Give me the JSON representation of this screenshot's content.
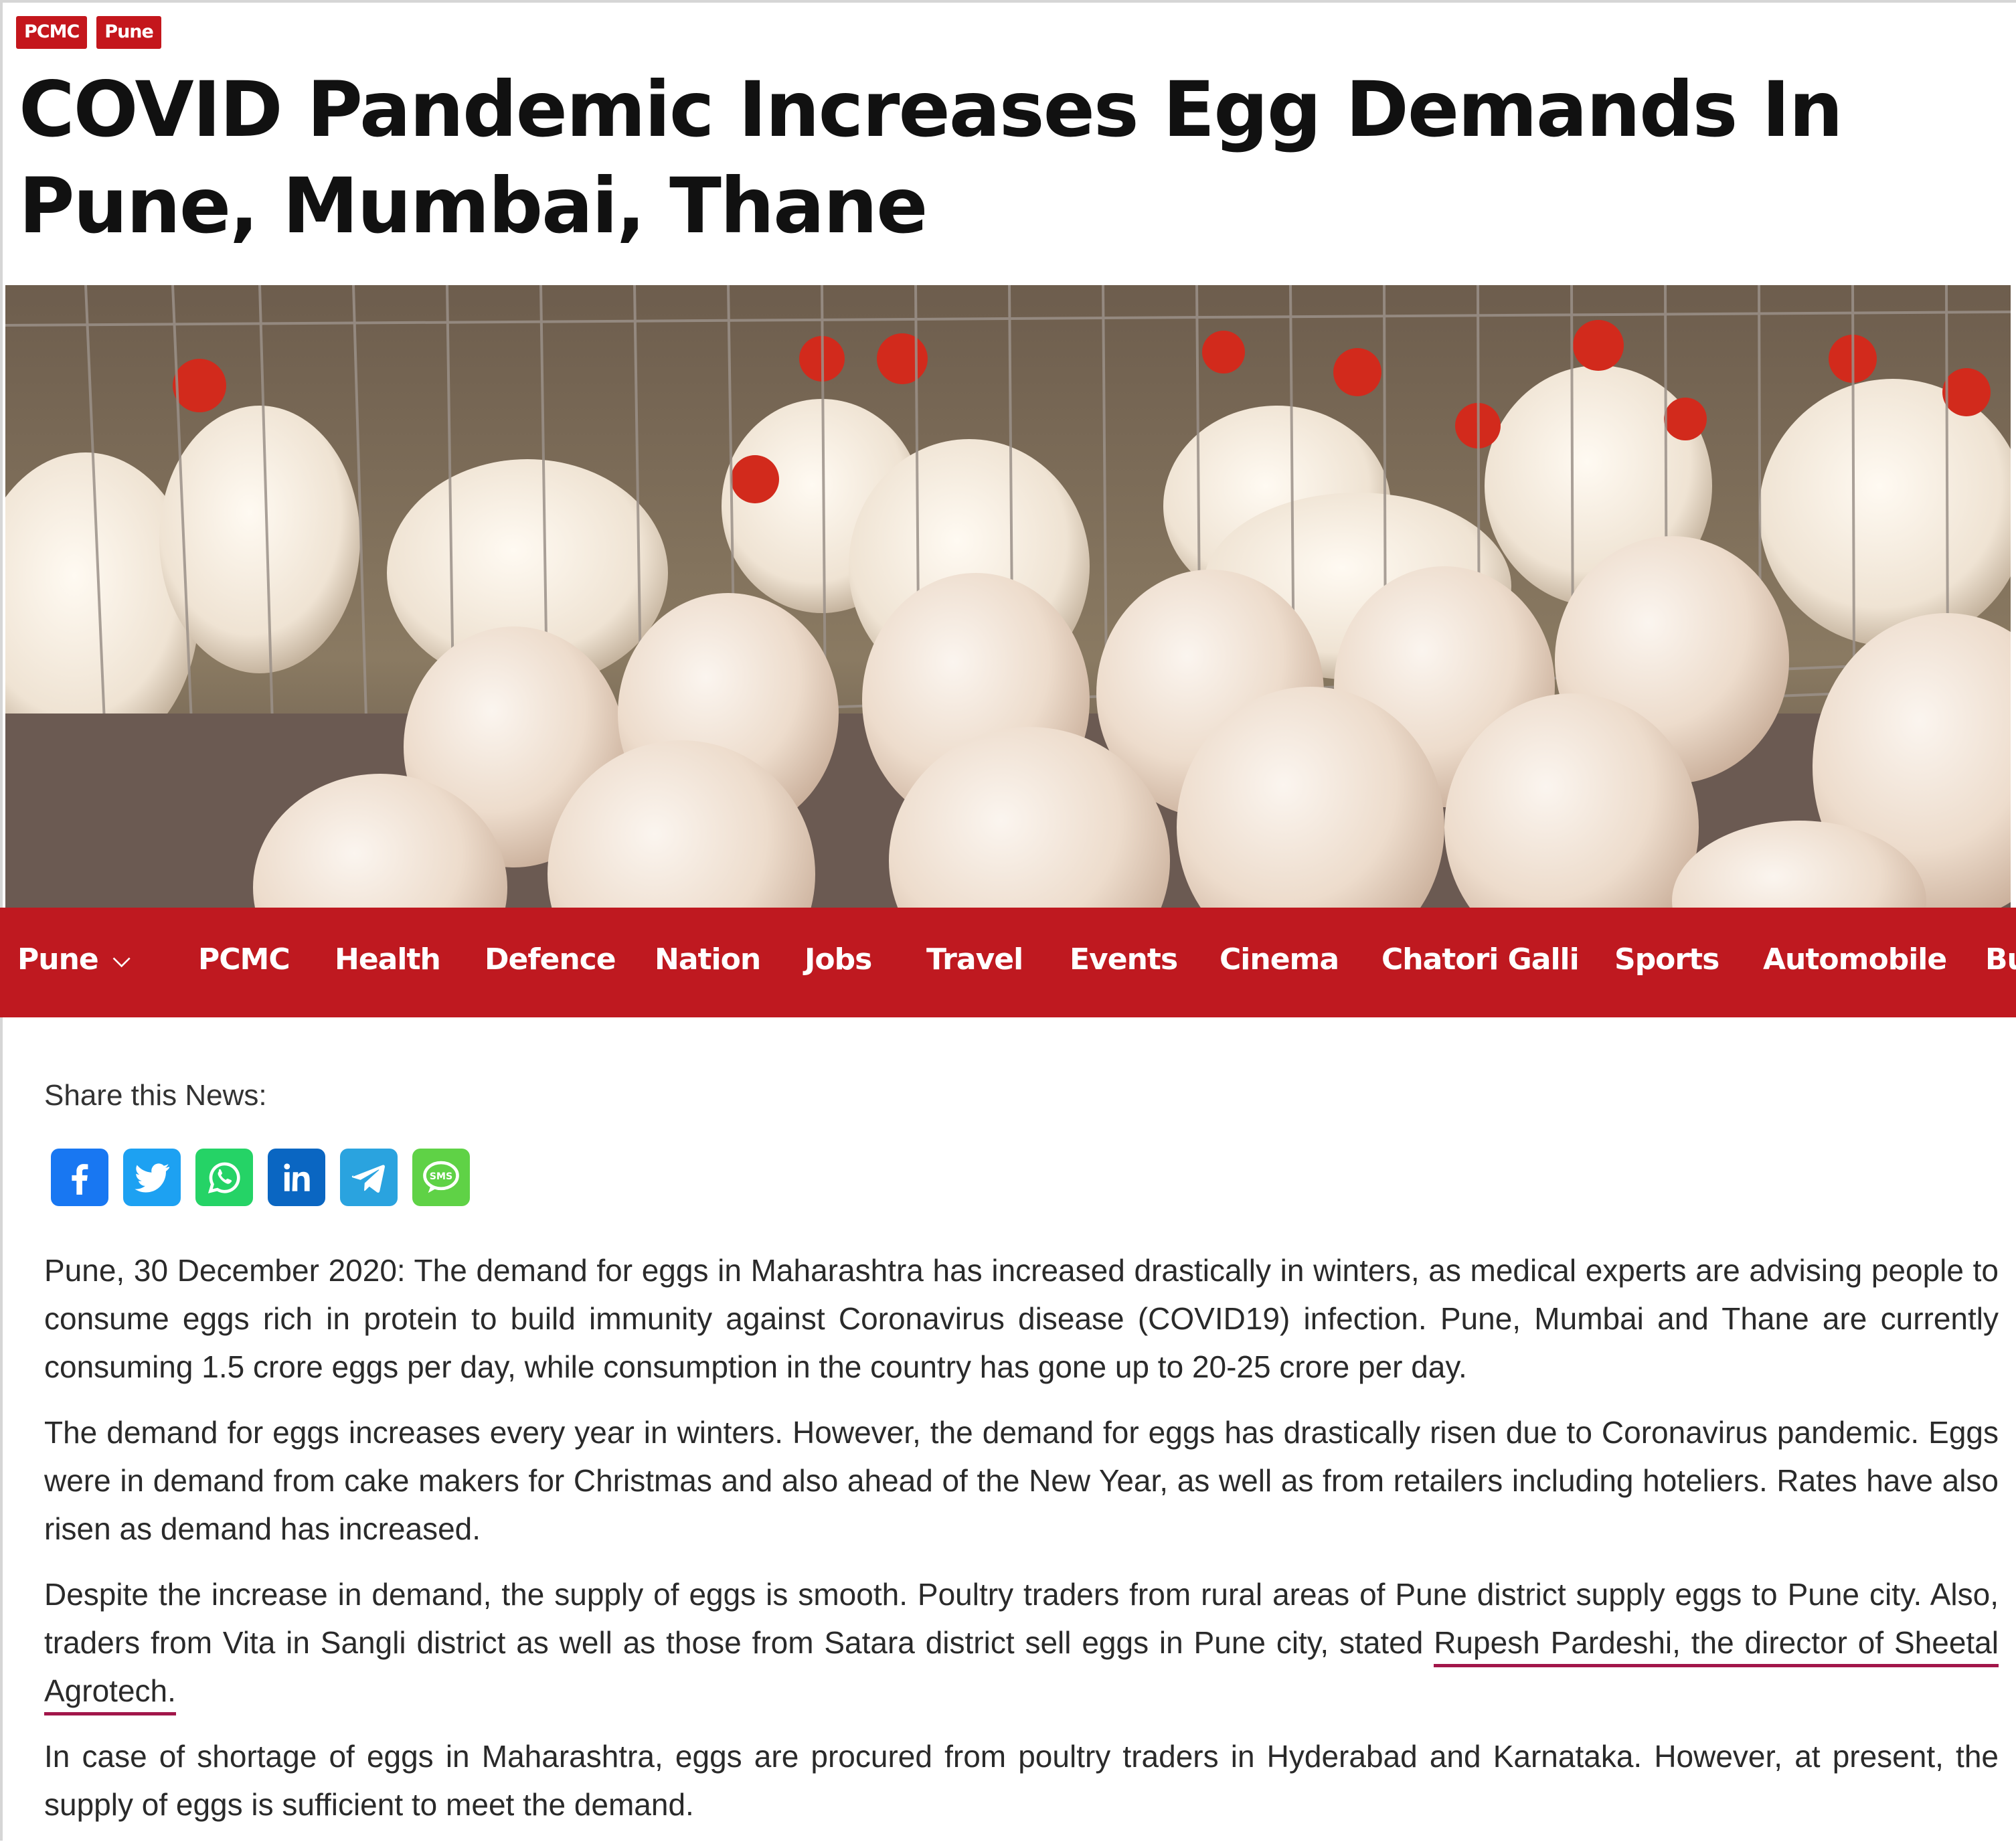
{
  "tags": [
    "PCMC",
    "Pune"
  ],
  "headline": "COVID Pandemic Increases Egg Demands In Pune, Mumbai, Thane",
  "nav": {
    "items": [
      "Pune",
      "PCMC",
      "Health",
      "Defence",
      "Nation",
      "Jobs",
      "Travel",
      "Events",
      "Cinema",
      "Chatori Galli",
      "Sports",
      "Automobile",
      "Bu"
    ],
    "dropdown_icon": "chevron-down-icon"
  },
  "share": {
    "label": "Share this News:",
    "buttons": [
      {
        "name": "facebook",
        "icon": "facebook-icon",
        "color": "#1877f2"
      },
      {
        "name": "twitter",
        "icon": "twitter-icon",
        "color": "#1da1f2"
      },
      {
        "name": "whatsapp",
        "icon": "whatsapp-icon",
        "color": "#25d366"
      },
      {
        "name": "linkedin",
        "icon": "linkedin-icon",
        "color": "#0a66c2"
      },
      {
        "name": "telegram",
        "icon": "telegram-icon",
        "color": "#2aa3df"
      },
      {
        "name": "sms",
        "icon": "sms-icon",
        "color": "#5fd246",
        "text": "SMS"
      }
    ]
  },
  "article": {
    "p1": "Pune, 30 December 2020: The demand for eggs in Maharashtra has increased drastically in winters, as medical experts are advising people to consume eggs rich in protein to build immunity against Coronavirus disease (COVID19) infection. Pune, Mumbai and Thane are currently consuming 1.5 crore eggs per day, while consumption in the country has gone up to 20-25 crore per day.",
    "p2": "The demand for eggs increases every year in winters. However, the demand for eggs has drastically risen due to Coronavirus pandemic. Eggs were in demand from cake makers for Christmas and also ahead of the New Year, as well as from retailers including hoteliers. Rates have also risen as demand has increased.",
    "p3_before": "Despite the increase in demand, the supply of eggs is smooth. Poultry traders from rural areas of Pune district supply eggs to Pune city. Also, traders from Vita in Sangli district as well as those from Satara district sell eggs in Pune city, stated ",
    "p3_highlight": "Rupesh Pardeshi, the director of Sheetal Agrotech.",
    "p4": "In case of shortage of eggs in Maharashtra, eggs are procured from poultry traders in Hyderabad and Karnataka. However, at present, the supply of eggs is sufficient to meet the demand."
  },
  "colors": {
    "brand_red": "#bf1920",
    "highlight_underline": "#a2164a"
  }
}
